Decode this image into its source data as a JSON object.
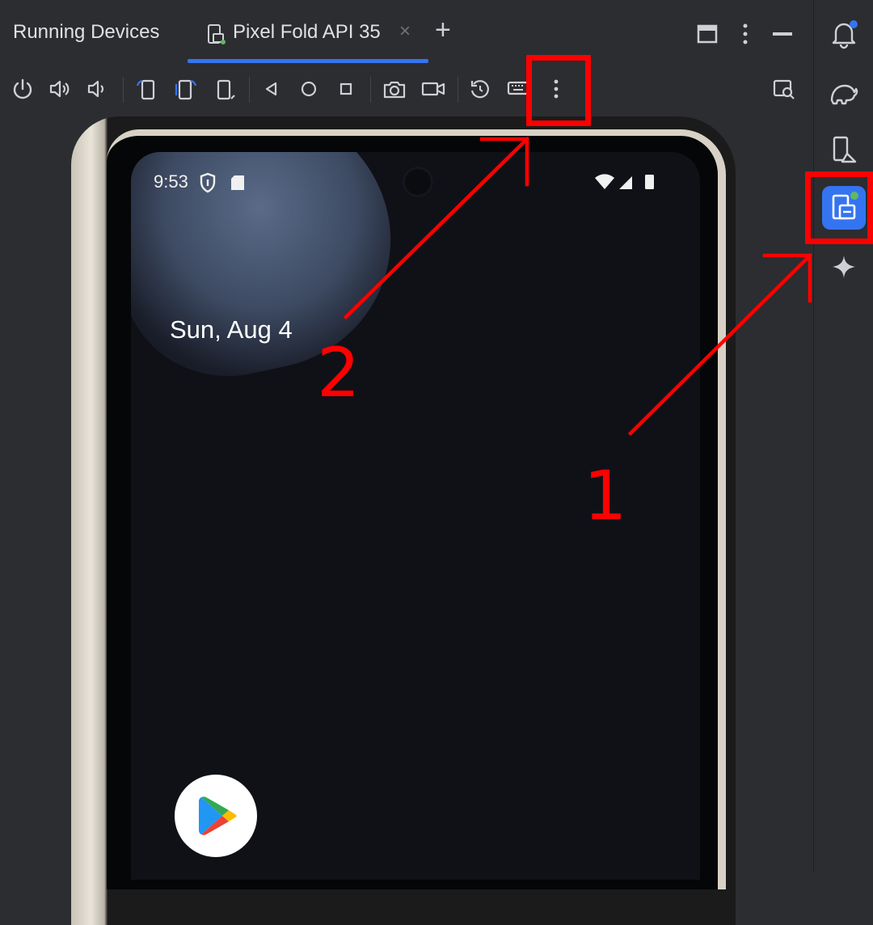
{
  "header": {
    "title": "Running Devices",
    "tab": {
      "label": "Pixel Fold API 35",
      "close": "×",
      "active": true
    },
    "add_tab": "+",
    "actions": [
      "window-icon",
      "more-vert-icon",
      "minimize-icon"
    ]
  },
  "toolbar": {
    "buttons": [
      "power-icon",
      "volume-up-icon",
      "volume-down-icon",
      "rotate-left-icon",
      "rotate-right-icon",
      "fold-posture-icon",
      "back-icon",
      "home-icon",
      "overview-icon",
      "screenshot-icon",
      "screen-record-icon",
      "reset-icon",
      "keyboard-icon",
      "more-options-icon",
      "device-mirroring-icon"
    ]
  },
  "right_stripe": {
    "items": [
      "notifications-icon",
      "gradle-elephant-icon",
      "device-manager-icon",
      "running-devices-icon",
      "ai-sparkle-icon"
    ],
    "active": "running-devices-icon"
  },
  "device": {
    "status_time": "9:53",
    "date": "Sun, Aug 4",
    "app": "play-store-icon"
  },
  "annotations": {
    "label_1": "1",
    "label_2": "2",
    "color": "#ff0000"
  },
  "colors": {
    "accent": "#3574f0",
    "background": "#2b2d30",
    "annotation": "#ff0000"
  }
}
